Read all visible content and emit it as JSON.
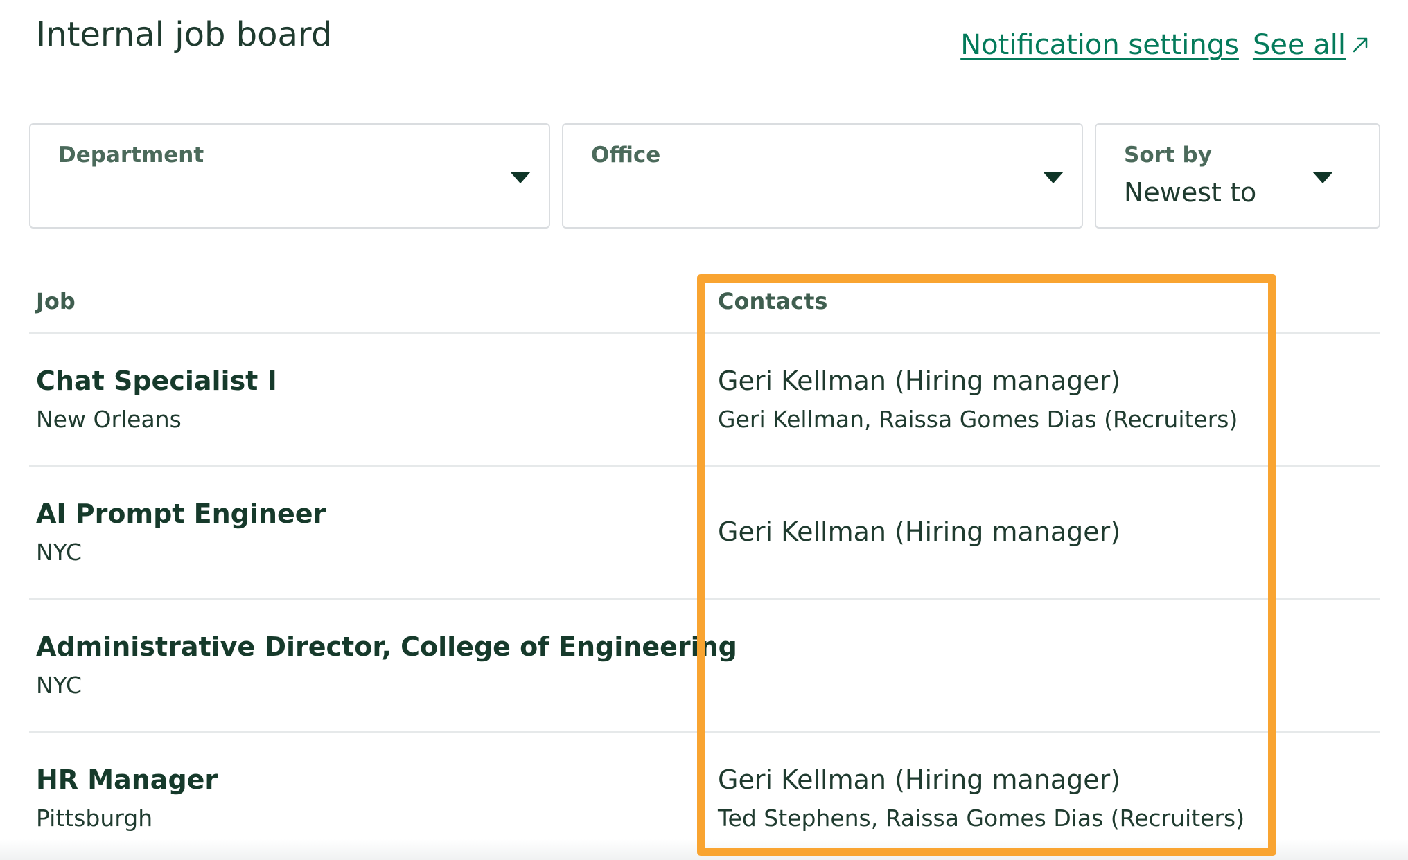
{
  "header": {
    "title": "Internal job board",
    "notification_settings_label": "Notification settings",
    "see_all_label": "See all",
    "link_color": "#047a5a"
  },
  "filters": {
    "department": {
      "label": "Department",
      "value": ""
    },
    "office": {
      "label": "Office",
      "value": ""
    },
    "sort_by": {
      "label": "Sort by",
      "value": "Newest to"
    }
  },
  "table": {
    "columns": [
      "Job",
      "Contacts"
    ],
    "rows": [
      {
        "title": "Chat Specialist I",
        "location": "New Orleans",
        "hiring_manager": "Geri Kellman (Hiring manager)",
        "recruiters": "Geri Kellman, Raissa Gomes Dias (Recruiters)"
      },
      {
        "title": "AI Prompt Engineer",
        "location": "NYC",
        "hiring_manager": "Geri Kellman (Hiring manager)",
        "recruiters": ""
      },
      {
        "title": "Administrative Director, College of Engineering",
        "location": "NYC",
        "hiring_manager": "",
        "recruiters": ""
      },
      {
        "title": "HR Manager",
        "location": "Pittsburgh",
        "hiring_manager": "Geri Kellman (Hiring manager)",
        "recruiters": "Ted Stephens, Raissa Gomes Dias (Recruiters)"
      }
    ]
  },
  "highlight": {
    "color": "#f9a431",
    "target": "Contacts"
  }
}
